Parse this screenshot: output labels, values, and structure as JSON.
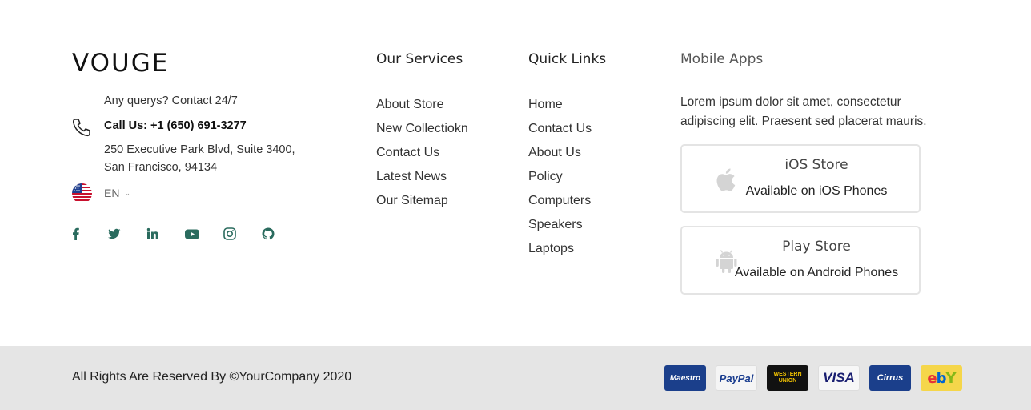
{
  "brand": {
    "logo": "VOUGE",
    "contact_intro": "Any querys? Contact 24/7",
    "phone_line": "Call Us: +1 (650) 691-3277",
    "address_line1": "250 Executive Park Blvd, Suite 3400,",
    "address_line2": "San Francisco, 94134",
    "language": "EN",
    "socials": [
      {
        "icon": "facebook-icon"
      },
      {
        "icon": "twitter-icon"
      },
      {
        "icon": "linkedin-icon"
      },
      {
        "icon": "youtube-icon"
      },
      {
        "icon": "instagram-icon"
      },
      {
        "icon": "github-icon"
      }
    ],
    "social_color": "#2a6b5e"
  },
  "services": {
    "title": "Our Services",
    "items": [
      "About Store",
      "New Collectiokn",
      "Contact Us",
      "Latest News",
      "Our Sitemap"
    ]
  },
  "quick_links": {
    "title": "Quick Links",
    "items": [
      "Home",
      "Contact Us",
      "About Us",
      "Policy",
      "Computers",
      "Speakers",
      "Laptops"
    ]
  },
  "apps": {
    "title": "Mobile Apps",
    "description": "Lorem ipsum dolor sit amet, consectetur adipiscing elit. Praesent sed placerat mauris.",
    "ios": {
      "name": "iOS Store",
      "sub": "Available on iOS Phones",
      "icon": "apple-icon"
    },
    "play": {
      "name": "Play Store",
      "sub": "Available on Android Phones",
      "icon": "android-icon"
    }
  },
  "bottom": {
    "copyright": "All Rights Are Reserved By ©YourCompany 2020",
    "payments": [
      {
        "name": "maestro-icon",
        "label": "Maestro"
      },
      {
        "name": "paypal-icon",
        "label": "PayPal"
      },
      {
        "name": "western-union-icon",
        "label": "WESTERN UNION"
      },
      {
        "name": "visa-icon",
        "label": "VISA"
      },
      {
        "name": "cirrus-icon",
        "label": "Cirrus"
      },
      {
        "name": "ebay-icon",
        "label": "ebY"
      }
    ]
  }
}
